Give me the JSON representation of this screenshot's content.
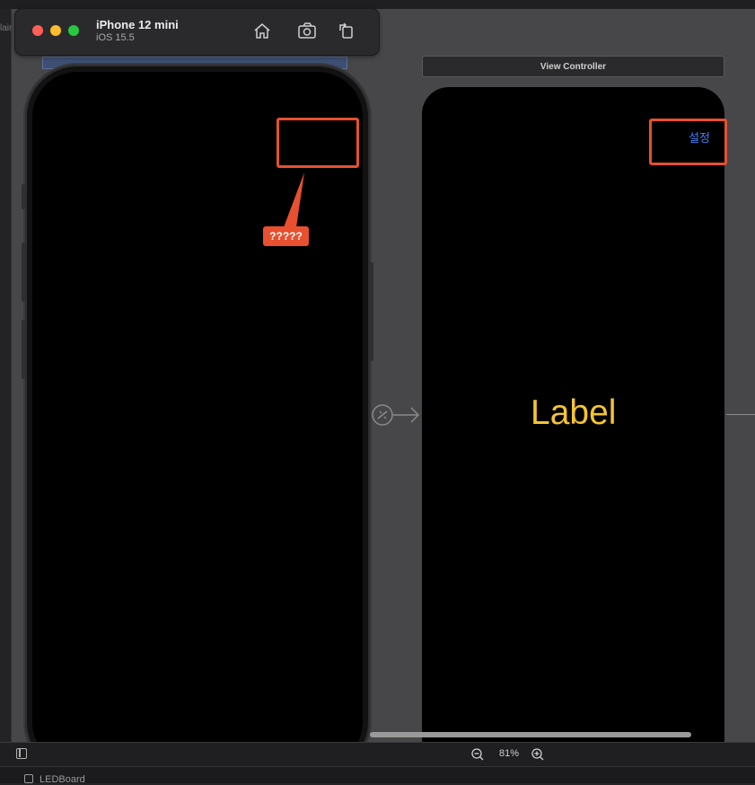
{
  "simulator": {
    "device_name": "iPhone 12 mini",
    "os_version": "iOS 15.5",
    "icons": [
      "home-icon",
      "screenshot-icon",
      "rotate-icon"
    ]
  },
  "annotation": {
    "tag_text": "?????",
    "color": "#e8502f"
  },
  "view_controller": {
    "title": "View Controller",
    "button_label": "설정",
    "label_text": "Label",
    "button_color": "#3b82f6",
    "label_color": "#f4c430"
  },
  "editor": {
    "left_gutter_text": "lain",
    "zoom_level": "81%",
    "status_item": "LEDBoard"
  }
}
